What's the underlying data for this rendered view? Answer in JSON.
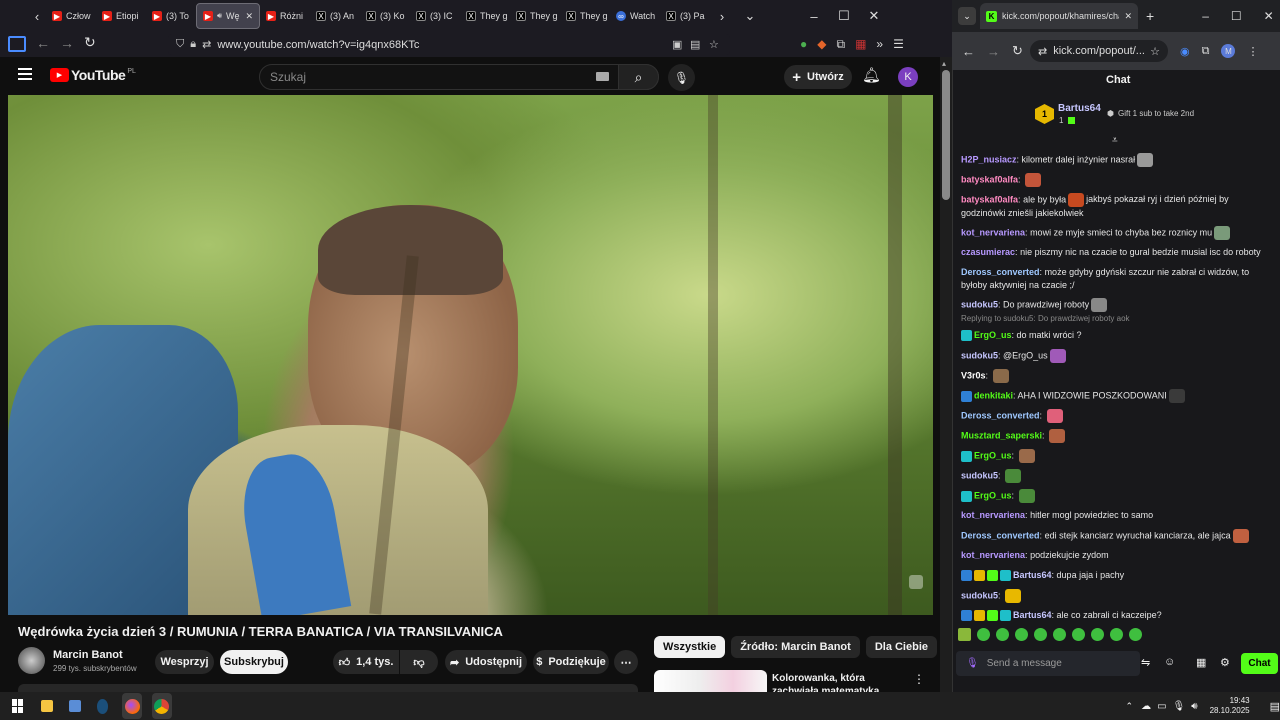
{
  "firefox": {
    "tabs": [
      {
        "label": "Człow",
        "icon": "youtube-icon"
      },
      {
        "label": "Etiopi",
        "icon": "youtube-icon"
      },
      {
        "label": "(3) To",
        "icon": "youtube-icon"
      },
      {
        "label": "Wę",
        "icon": "youtube-icon",
        "active": true
      },
      {
        "label": "Różni",
        "icon": "youtube-icon"
      },
      {
        "label": "(3) An",
        "icon": "x-icon"
      },
      {
        "label": "(3) Ko",
        "icon": "x-icon"
      },
      {
        "label": "(3) IC",
        "icon": "x-icon"
      },
      {
        "label": "They g",
        "icon": "x-icon"
      },
      {
        "label": "They g",
        "icon": "x-icon"
      },
      {
        "label": "They g",
        "icon": "x-icon"
      },
      {
        "label": "Watch",
        "icon": "watch-icon"
      },
      {
        "label": "(3) Pa",
        "icon": "x-icon"
      }
    ],
    "url": "www.youtube.com/watch?v=ig4qnx68KTc"
  },
  "youtube": {
    "logo": "YouTube",
    "region": "PL",
    "search_placeholder": "Szukaj",
    "create_label": "Utwórz",
    "avatar": "K",
    "video_title": "Wędrówka życia dzień 3 / RUMUNIA / TERRA BANATICA / VIA TRANSILVANICA",
    "channel_name": "Marcin Banot",
    "subscribers": "299 tys. subskrybentów",
    "support_label": "Wesprzyj",
    "subscribe_label": "Subskrybuj",
    "likes": "1,4 tys.",
    "share_label": "Udostępnij",
    "thanks_label": "Podziękuje",
    "chips": [
      "Wszystkie",
      "Źródło: Marcin Banot",
      "Dla Ciebie"
    ],
    "rec_title": "Kolorowanka, która zachwiała matematyką"
  },
  "kick": {
    "tab_title": "kick.com/popout/khamires/cha",
    "url": "kick.com/popout/...",
    "avatar": "M",
    "chat_title": "Chat",
    "top_gifter": "Bartus64",
    "top_gifter_count": "1",
    "gift_text": "Gift 1 sub to take 2nd",
    "reply_text": "Replying to sudoku5: Do prawdziwej roboty aok",
    "input_placeholder": "Send a message",
    "chat_button": "Chat",
    "messages": [
      {
        "user": "H2P_nusiacz",
        "text": "kilometr dalej inżynier nasrał",
        "color": "#b799ff"
      },
      {
        "user": "batyskaf0alfa",
        "text": "",
        "color": "#ff8ac1"
      },
      {
        "user": "batyskaf0alfa",
        "text": "ale by była",
        "text2": "jakbyś pokazał ryj i dzień później by godzinówki zniešli jakiekolwiek",
        "color": "#ff8ac1"
      },
      {
        "user": "kot_nervariena",
        "text": "mowi ze myje smieci to chyba bez roznicy mu",
        "color": "#b799ff"
      },
      {
        "user": "czasumierac",
        "text": "nie piszmy nic na czacie to gural bedzie musial isc do roboty",
        "color": "#b799ff"
      },
      {
        "user": "Deross_converted",
        "text": "może gdyby gdyński szczur nie zabrał ci widzów, to byłoby aktywniej na czacie ;/",
        "color": "#9fc8ff"
      },
      {
        "user": "sudoku5",
        "text": "Do prawdziwej roboty",
        "color": "#c7c7ff"
      },
      {
        "user": "ErgO_us",
        "text": "do matki wróci ?",
        "color": "#53fc18"
      },
      {
        "user": "sudoku5",
        "text": "@ErgO_us",
        "color": "#c7c7ff"
      },
      {
        "user": "V3r0s",
        "text": "",
        "color": "#ffffff"
      },
      {
        "user": "denkitaki",
        "text": "AHA I WIDZOWIE POSZKODOWANI",
        "color": "#53fc18"
      },
      {
        "user": "Deross_converted",
        "text": "",
        "color": "#9fc8ff"
      },
      {
        "user": "Musztard_saperski",
        "text": "",
        "color": "#53fc18"
      },
      {
        "user": "ErgO_us",
        "text": "",
        "color": "#53fc18"
      },
      {
        "user": "sudoku5",
        "text": "",
        "color": "#c7c7ff"
      },
      {
        "user": "ErgO_us",
        "text": "",
        "color": "#53fc18"
      },
      {
        "user": "kot_nervariena",
        "text": "hitler mogl powiedziec to samo",
        "color": "#b799ff"
      },
      {
        "user": "Deross_converted",
        "text": "edi stejk kanciarz wyruchał kanciarza, ale jajca",
        "color": "#9fc8ff"
      },
      {
        "user": "kot_nervariena",
        "text": "podziekujcie zydom",
        "color": "#b799ff"
      },
      {
        "user": "Bartus64",
        "text": "dupa jaja i pachy",
        "color": "#c7c7ff"
      },
      {
        "user": "sudoku5",
        "text": "",
        "color": "#c7c7ff"
      },
      {
        "user": "Bartus64",
        "text": "ale co zabrali ci kaczeipe?",
        "color": "#c7c7ff"
      }
    ]
  },
  "taskbar": {
    "time": "19:43",
    "date": "28.10.2025"
  }
}
